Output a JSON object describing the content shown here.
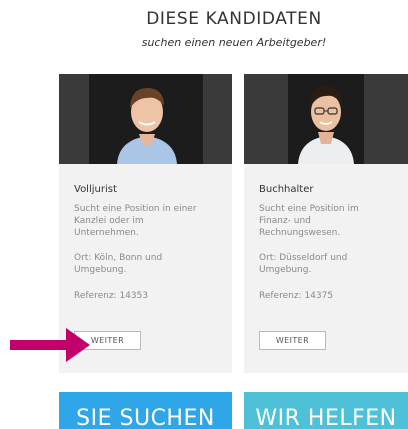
{
  "header": {
    "title": "DIESE KANDIDATEN",
    "subtitle": "suchen einen neuen Arbeitgeber!"
  },
  "cards": [
    {
      "role": "Volljurist",
      "description": "Sucht eine Position in einer\nKanzlei oder im\nUnternehmen.",
      "location": "Ort: Köln, Bonn und\nUmgebung.",
      "reference": "Referenz: 14353",
      "button_label": "WEITER"
    },
    {
      "role": "Buchhalter",
      "description": "Sucht eine Position im\nFinanz- und\nRechnungswesen.",
      "location": "Ort: Düsseldorf und\nUmgebung.",
      "reference": "Referenz: 14375",
      "button_label": "WEITER"
    }
  ],
  "banners": [
    {
      "label": "SIE SUCHEN"
    },
    {
      "label": "WIR HELFEN"
    }
  ],
  "colors": {
    "arrow": "#c2006b",
    "banner_left": "#2fa6e8",
    "banner_right": "#4ec1d8",
    "card_bg": "#f2f2f2"
  }
}
